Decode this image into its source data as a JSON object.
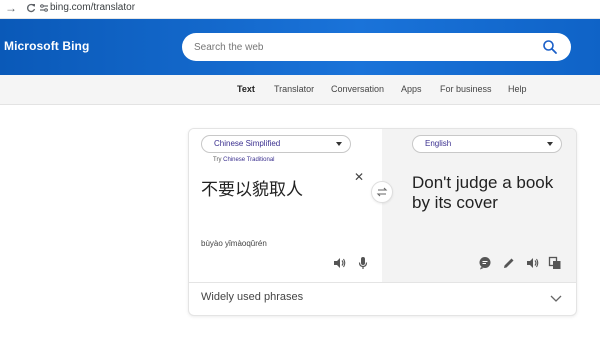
{
  "browser": {
    "url": "bing.com/translator"
  },
  "header": {
    "brand": "Microsoft Bing",
    "search_placeholder": "Search the web"
  },
  "subnav": {
    "items": [
      "Text",
      "Translator",
      "Conversation",
      "Apps",
      "For business",
      "Help"
    ],
    "active": "Text"
  },
  "translator": {
    "source_language": "Chinese Simplified",
    "try_prefix": "Try",
    "try_suggestion": "Chinese Traditional",
    "source_text": "不要以貌取人",
    "transliteration": "bùyào yǐmàoqǔrén",
    "target_language": "English",
    "target_text": "Don't judge a book by its cover",
    "phrases_label": "Widely used phrases"
  },
  "colors": {
    "header_blue": "#0e62c4",
    "link_purple": "#3a2f8f",
    "target_pane": "#f3f3f3"
  }
}
